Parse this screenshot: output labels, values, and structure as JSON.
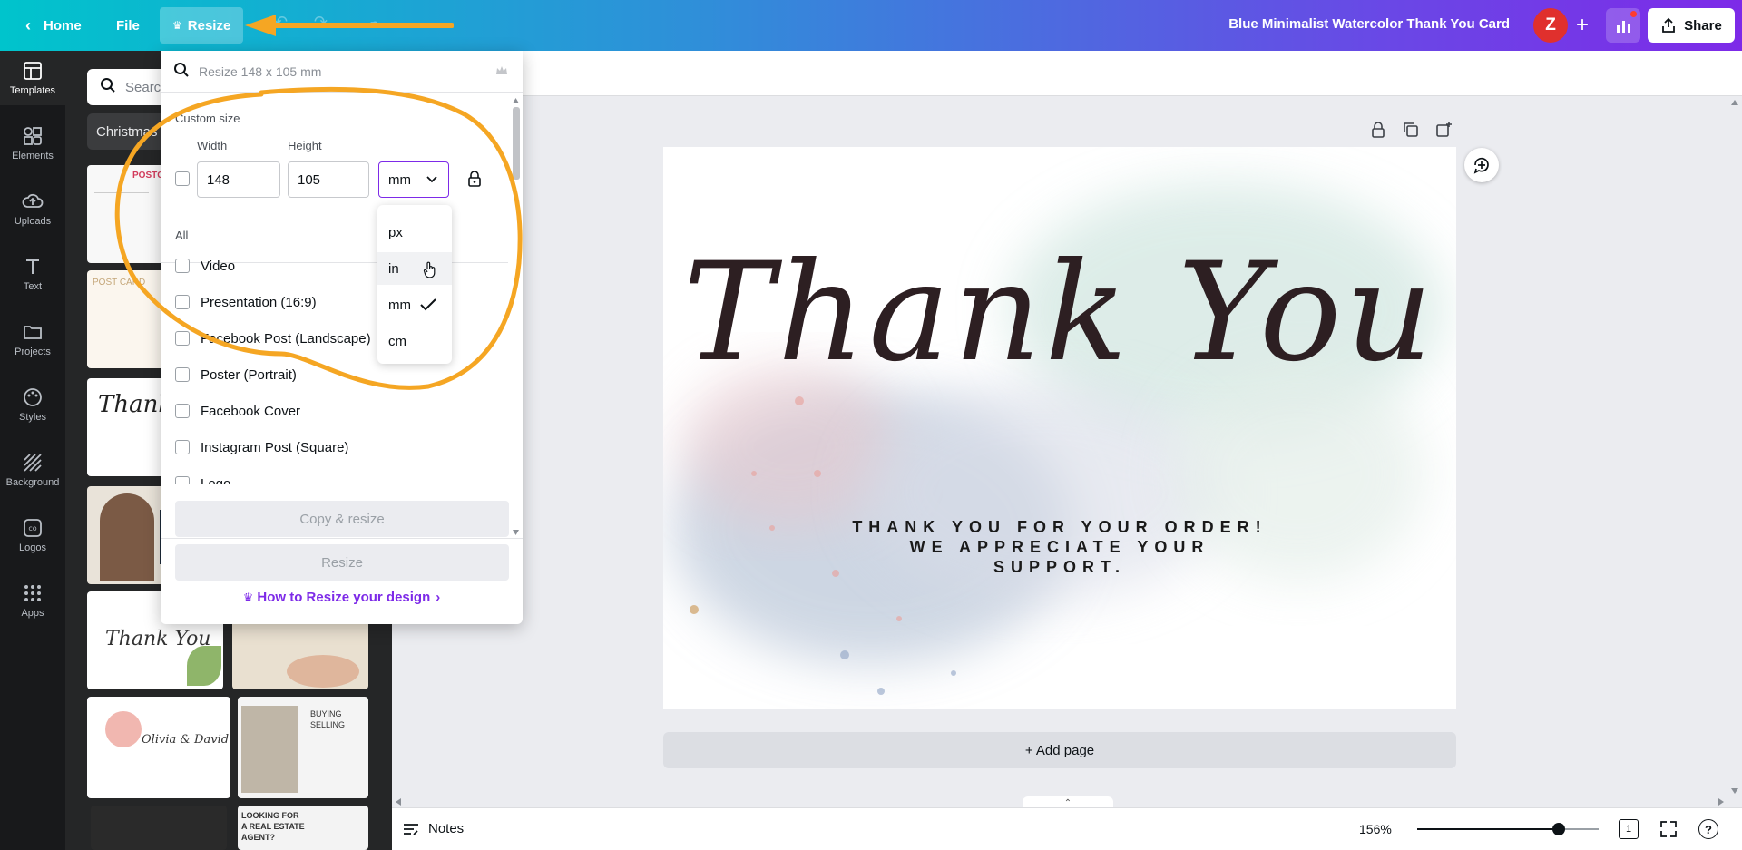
{
  "topbar": {
    "home_label": "Home",
    "file_label": "File",
    "resize_label": "Resize",
    "design_title": "Blue Minimalist Watercolor Thank You Card",
    "avatar_letter": "Z",
    "share_label": "Share"
  },
  "rail": {
    "items": [
      {
        "label": "Templates",
        "icon": "templates-icon"
      },
      {
        "label": "Elements",
        "icon": "elements-icon"
      },
      {
        "label": "Uploads",
        "icon": "uploads-icon"
      },
      {
        "label": "Text",
        "icon": "text-icon"
      },
      {
        "label": "Projects",
        "icon": "folder-icon"
      },
      {
        "label": "Styles",
        "icon": "palette-icon"
      },
      {
        "label": "Background",
        "icon": "background-icon"
      },
      {
        "label": "Logos",
        "icon": "logos-icon"
      },
      {
        "label": "Apps",
        "icon": "apps-icon"
      }
    ]
  },
  "panel": {
    "search_placeholder": "Searc",
    "chip_label": "Christmas"
  },
  "resize_popover": {
    "search_placeholder": "Resize 148 x 105 mm",
    "custom_size_label": "Custom size",
    "width_label": "Width",
    "height_label": "Height",
    "width_value": "148",
    "height_value": "105",
    "unit_value": "mm",
    "all_label": "All",
    "list": [
      "Video",
      "Presentation (16:9)",
      "Facebook Post (Landscape)",
      "Poster (Portrait)",
      "Facebook Cover",
      "Instagram Post (Square)",
      "Logo"
    ],
    "copy_resize_label": "Copy & resize",
    "resize_label": "Resize",
    "how_to_label": "How to Resize your design"
  },
  "unit_dropdown": {
    "options": [
      "px",
      "in",
      "mm",
      "cm"
    ],
    "selected": "mm",
    "hovered": "in"
  },
  "card": {
    "script_text": "Thank You",
    "sub_line1": "THANK YOU FOR YOUR ORDER!",
    "sub_line2": "WE APPRECIATE YOUR",
    "sub_line3": "SUPPORT."
  },
  "canvas": {
    "add_page_label": "+ Add page"
  },
  "bottombar": {
    "notes_label": "Notes",
    "zoom_label": "156%",
    "zoom_fraction": 0.78,
    "page_count": "1",
    "help_label": "?"
  },
  "colors": {
    "accent": "#7d2ae8",
    "annotation": "#f5a623",
    "avatar": "#e0302d"
  }
}
